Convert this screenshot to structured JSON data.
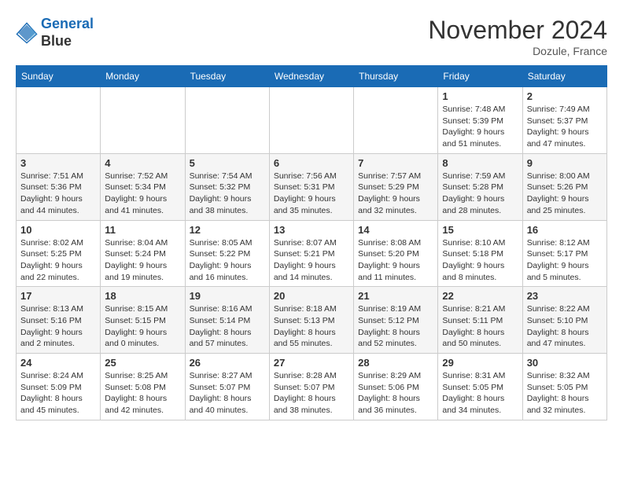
{
  "header": {
    "logo_line1": "General",
    "logo_line2": "Blue",
    "month_title": "November 2024",
    "location": "Dozule, France"
  },
  "weekdays": [
    "Sunday",
    "Monday",
    "Tuesday",
    "Wednesday",
    "Thursday",
    "Friday",
    "Saturday"
  ],
  "weeks": [
    [
      {
        "day": "",
        "info": ""
      },
      {
        "day": "",
        "info": ""
      },
      {
        "day": "",
        "info": ""
      },
      {
        "day": "",
        "info": ""
      },
      {
        "day": "",
        "info": ""
      },
      {
        "day": "1",
        "info": "Sunrise: 7:48 AM\nSunset: 5:39 PM\nDaylight: 9 hours and 51 minutes."
      },
      {
        "day": "2",
        "info": "Sunrise: 7:49 AM\nSunset: 5:37 PM\nDaylight: 9 hours and 47 minutes."
      }
    ],
    [
      {
        "day": "3",
        "info": "Sunrise: 7:51 AM\nSunset: 5:36 PM\nDaylight: 9 hours and 44 minutes."
      },
      {
        "day": "4",
        "info": "Sunrise: 7:52 AM\nSunset: 5:34 PM\nDaylight: 9 hours and 41 minutes."
      },
      {
        "day": "5",
        "info": "Sunrise: 7:54 AM\nSunset: 5:32 PM\nDaylight: 9 hours and 38 minutes."
      },
      {
        "day": "6",
        "info": "Sunrise: 7:56 AM\nSunset: 5:31 PM\nDaylight: 9 hours and 35 minutes."
      },
      {
        "day": "7",
        "info": "Sunrise: 7:57 AM\nSunset: 5:29 PM\nDaylight: 9 hours and 32 minutes."
      },
      {
        "day": "8",
        "info": "Sunrise: 7:59 AM\nSunset: 5:28 PM\nDaylight: 9 hours and 28 minutes."
      },
      {
        "day": "9",
        "info": "Sunrise: 8:00 AM\nSunset: 5:26 PM\nDaylight: 9 hours and 25 minutes."
      }
    ],
    [
      {
        "day": "10",
        "info": "Sunrise: 8:02 AM\nSunset: 5:25 PM\nDaylight: 9 hours and 22 minutes."
      },
      {
        "day": "11",
        "info": "Sunrise: 8:04 AM\nSunset: 5:24 PM\nDaylight: 9 hours and 19 minutes."
      },
      {
        "day": "12",
        "info": "Sunrise: 8:05 AM\nSunset: 5:22 PM\nDaylight: 9 hours and 16 minutes."
      },
      {
        "day": "13",
        "info": "Sunrise: 8:07 AM\nSunset: 5:21 PM\nDaylight: 9 hours and 14 minutes."
      },
      {
        "day": "14",
        "info": "Sunrise: 8:08 AM\nSunset: 5:20 PM\nDaylight: 9 hours and 11 minutes."
      },
      {
        "day": "15",
        "info": "Sunrise: 8:10 AM\nSunset: 5:18 PM\nDaylight: 9 hours and 8 minutes."
      },
      {
        "day": "16",
        "info": "Sunrise: 8:12 AM\nSunset: 5:17 PM\nDaylight: 9 hours and 5 minutes."
      }
    ],
    [
      {
        "day": "17",
        "info": "Sunrise: 8:13 AM\nSunset: 5:16 PM\nDaylight: 9 hours and 2 minutes."
      },
      {
        "day": "18",
        "info": "Sunrise: 8:15 AM\nSunset: 5:15 PM\nDaylight: 9 hours and 0 minutes."
      },
      {
        "day": "19",
        "info": "Sunrise: 8:16 AM\nSunset: 5:14 PM\nDaylight: 8 hours and 57 minutes."
      },
      {
        "day": "20",
        "info": "Sunrise: 8:18 AM\nSunset: 5:13 PM\nDaylight: 8 hours and 55 minutes."
      },
      {
        "day": "21",
        "info": "Sunrise: 8:19 AM\nSunset: 5:12 PM\nDaylight: 8 hours and 52 minutes."
      },
      {
        "day": "22",
        "info": "Sunrise: 8:21 AM\nSunset: 5:11 PM\nDaylight: 8 hours and 50 minutes."
      },
      {
        "day": "23",
        "info": "Sunrise: 8:22 AM\nSunset: 5:10 PM\nDaylight: 8 hours and 47 minutes."
      }
    ],
    [
      {
        "day": "24",
        "info": "Sunrise: 8:24 AM\nSunset: 5:09 PM\nDaylight: 8 hours and 45 minutes."
      },
      {
        "day": "25",
        "info": "Sunrise: 8:25 AM\nSunset: 5:08 PM\nDaylight: 8 hours and 42 minutes."
      },
      {
        "day": "26",
        "info": "Sunrise: 8:27 AM\nSunset: 5:07 PM\nDaylight: 8 hours and 40 minutes."
      },
      {
        "day": "27",
        "info": "Sunrise: 8:28 AM\nSunset: 5:07 PM\nDaylight: 8 hours and 38 minutes."
      },
      {
        "day": "28",
        "info": "Sunrise: 8:29 AM\nSunset: 5:06 PM\nDaylight: 8 hours and 36 minutes."
      },
      {
        "day": "29",
        "info": "Sunrise: 8:31 AM\nSunset: 5:05 PM\nDaylight: 8 hours and 34 minutes."
      },
      {
        "day": "30",
        "info": "Sunrise: 8:32 AM\nSunset: 5:05 PM\nDaylight: 8 hours and 32 minutes."
      }
    ]
  ]
}
